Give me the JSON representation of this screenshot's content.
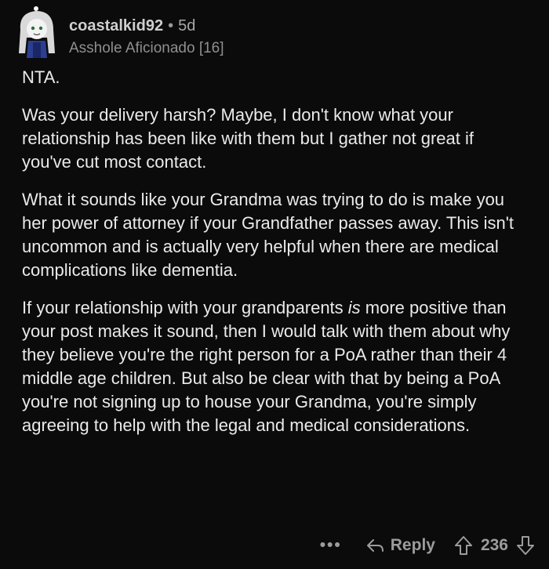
{
  "comment": {
    "username": "coastalkid92",
    "separator": "•",
    "age": "5d",
    "flair": "Asshole Aficionado [16]",
    "paragraphs": [
      "NTA.",
      "Was your delivery harsh? Maybe, I don't know what your relationship has been like with them but I gather not great if you've cut most contact.",
      "What it sounds like your Grandma was trying to do is make you her power of attorney if your Grandfather passes away. This isn't uncommon and is actually very helpful when there are medical complications like dementia."
    ],
    "paragraph4": {
      "before": "If your relationship with your grandparents ",
      "emphasis": "is",
      "after": " more positive than your post makes it sound, then I would talk with them about why they believe you're the right person for a PoA rather than their 4 middle age children. But also be clear with that by being a PoA you're not signing up to house your Grandma, you're simply agreeing to help with the legal and medical considerations."
    }
  },
  "actions": {
    "more": "•••",
    "reply": "Reply",
    "score": "236"
  },
  "icons": {
    "avatar": "avatar-icon",
    "reply": "reply-arrow-icon",
    "upvote": "upvote-arrow-icon",
    "downvote": "downvote-arrow-icon"
  }
}
